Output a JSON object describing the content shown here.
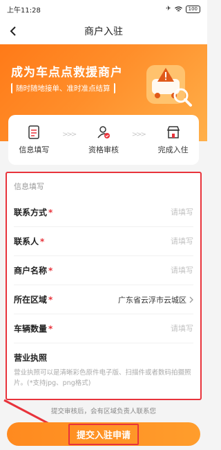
{
  "status_bar": {
    "time": "上午11:28",
    "battery": "100"
  },
  "nav": {
    "title": "商户入驻"
  },
  "banner": {
    "title": "成为车点点救援商户",
    "subtitle": "随时随地接单、准时准点结算"
  },
  "steps": [
    {
      "label": "信息填写",
      "icon": "form-icon"
    },
    {
      "label": "资格审核",
      "icon": "user-check-icon"
    },
    {
      "label": "完成入住",
      "icon": "store-icon"
    }
  ],
  "form": {
    "section_title": "信息填写",
    "fields": [
      {
        "label": "联系方式",
        "required": "*",
        "placeholder": "请填写"
      },
      {
        "label": "联系人",
        "required": "*",
        "placeholder": "请填写"
      },
      {
        "label": "商户名称",
        "required": "*",
        "placeholder": "请填写"
      },
      {
        "label": "所在区域",
        "required": "*",
        "value": "广东省云浮市云城区"
      },
      {
        "label": "车辆数量",
        "required": "*",
        "placeholder": "请填写"
      }
    ],
    "license": {
      "label": "营业执照",
      "hint": "营业执照可以是清晰彩色原件电子版、扫描件或者数码拍摄照片。(*支持jpg、png格式)"
    }
  },
  "footer_note": "提交审核后，会有区域负责人联系您",
  "submit_label": "提交入驻申请",
  "colors": {
    "accent": "#ff8a1f",
    "highlight": "#e8333b"
  }
}
